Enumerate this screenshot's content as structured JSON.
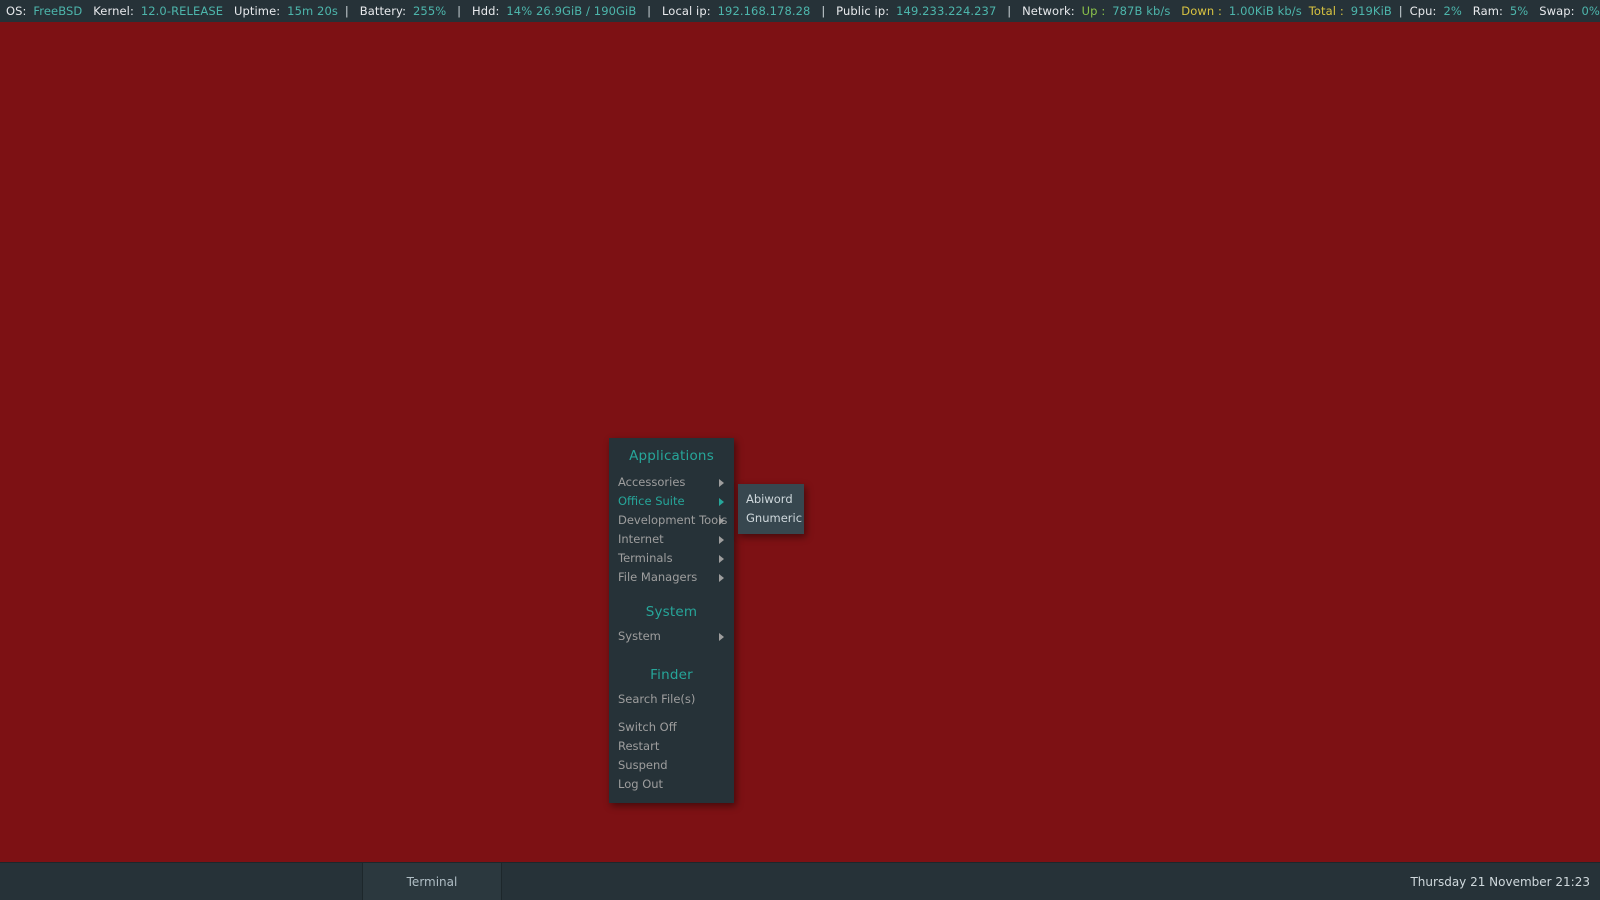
{
  "topbar": {
    "os_label": "OS:",
    "os_value": "FreeBSD",
    "kernel_label": "Kernel:",
    "kernel_value": "12.0-RELEASE",
    "uptime_label": "Uptime:",
    "uptime_value": "15m 20s",
    "sep1": "|",
    "battery_label": "Battery:",
    "battery_value": "255%",
    "sep2": "|",
    "hdd_label": "Hdd:",
    "hdd_value": "14% 26.9GiB / 190GiB",
    "sep3": "|",
    "localip_label": "Local ip:",
    "localip_value": "192.168.178.28",
    "sep4": "|",
    "publicip_label": "Public ip:",
    "publicip_value": "149.233.224.237",
    "sep5": "|",
    "network_label": "Network:",
    "up_label": "Up :",
    "up_value": "787B kb/s",
    "down_label": "Down :",
    "down_value": "1.00KiB kb/s",
    "total_label": "Total :",
    "total_value": "919KiB",
    "sep6": "|",
    "cpu_label": "Cpu:",
    "cpu_value": "2%",
    "ram_label": "Ram:",
    "ram_value": "5%",
    "swap_label": "Swap:",
    "swap_value": "0%"
  },
  "menu": {
    "applications_header": "Applications",
    "applications_items": [
      {
        "label": "Accessories",
        "active": false
      },
      {
        "label": "Office Suite",
        "active": true
      },
      {
        "label": "Development Tools",
        "active": false
      },
      {
        "label": "Internet",
        "active": false
      },
      {
        "label": "Terminals",
        "active": false
      },
      {
        "label": "File Managers",
        "active": false
      }
    ],
    "system_header": "System",
    "system_items": [
      {
        "label": "System",
        "active": false
      }
    ],
    "finder_header": "Finder",
    "finder_items": [
      {
        "label": "Search File(s)"
      }
    ],
    "power_items": [
      {
        "label": "Switch Off"
      },
      {
        "label": "Restart"
      },
      {
        "label": "Suspend"
      },
      {
        "label": "Log Out"
      }
    ]
  },
  "submenu": {
    "parent": "Office Suite",
    "items": [
      {
        "label": "Abiword"
      },
      {
        "label": "Gnumeric"
      }
    ]
  },
  "taskbar": {
    "window_button": "Terminal",
    "clock": "Thursday 21 November 21:23"
  },
  "colors": {
    "desktop": "#7d1114",
    "panel": "#263238",
    "submenu_panel": "#37474f",
    "accent_teal": "#26a69a",
    "value_teal": "#4db6ac",
    "value_green": "#8bc34a",
    "value_yellow": "#d9c441",
    "text_grey": "#9e9e9e",
    "text_light": "#cfd8dc"
  }
}
